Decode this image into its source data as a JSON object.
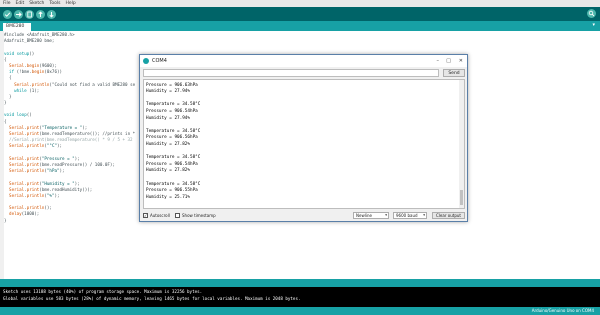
{
  "menu": [
    "File",
    "Edit",
    "Sketch",
    "Tools",
    "Help"
  ],
  "toolbar": {
    "verify_icon": "check-icon",
    "upload_icon": "arrow-right-icon",
    "new_icon": "new-file-icon",
    "open_icon": "open-arrow-up-icon",
    "save_icon": "save-arrow-down-icon",
    "serial_icon": "magnifier-icon"
  },
  "tab": {
    "label": "BME280",
    "menu_arrow": "▾"
  },
  "code_lines": [
    "#include <Adafruit_BME280.h>",
    "Adafruit_BME280 bme;",
    "",
    "void setup()",
    "{",
    "  Serial.begin(9600);",
    "  if (!bme.begin(0x76))",
    "  {",
    "    Serial.println(\"Could not find a valid BME280 se",
    "    while (1);",
    "  }",
    "}",
    "",
    "void loop()",
    "{",
    "  Serial.print(\"Temperature = \");",
    "  Serial.print(bme.readTemperature()); //prints in *",
    "  //Serial.print(bme.readTemperature() * 9 / 5 + 32",
    "  Serial.println(\"°C\");",
    "",
    "  Serial.print(\"Pressure = \");",
    "  Serial.print(bme.readPressure() / 100.0F);",
    "  Serial.println(\"hPa\");",
    "",
    "  Serial.print(\"Humidity = \");",
    "  Serial.print(bme.readHumidity());",
    "  Serial.println(\"%\");",
    "",
    "  Serial.println();",
    "  delay(1000);",
    "}"
  ],
  "console_lines": [
    "Sketch uses 13188 bytes (40%) of program storage space. Maximum is 32256 bytes.",
    "Global variables use 583 bytes (28%) of dynamic memory, leaving 1465 bytes for local variables. Maximum is 2048 bytes."
  ],
  "footer": "Arduino/Genuino Uno on COM4",
  "monitor": {
    "title": "COM4",
    "controls": {
      "minimize": "–",
      "maximize": "□",
      "close": "✕"
    },
    "send_label": "Send",
    "output_lines": [
      "Pressure = 906.62hPa",
      "Pressure = 906.63hPa",
      "Humidity = 27.94%",
      "",
      "Temperature = 34.58°C",
      "Pressure = 906.54hPa",
      "Humidity = 27.94%",
      "",
      "Temperature = 34.58°C",
      "Pressure = 906.56hPa",
      "Humidity = 27.82%",
      "",
      "Temperature = 34.58°C",
      "Pressure = 906.54hPa",
      "Humidity = 27.82%",
      "",
      "Temperature = 34.58°C",
      "Pressure = 906.55hPa",
      "Humidity = 25.71%"
    ],
    "autoscroll_label": "Autoscroll",
    "autoscroll_checked": "✓",
    "timestamp_label": "Show timestamp",
    "line_ending": "Newline",
    "baud": "9600 baud",
    "dropdown_arrow": "▾",
    "clear_label": "Clear output"
  }
}
